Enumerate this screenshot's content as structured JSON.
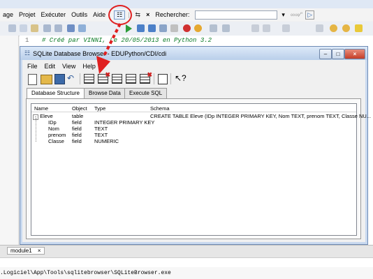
{
  "ide": {
    "menu": [
      "age",
      "Projet",
      "Exécuter",
      "Outils",
      "Aide"
    ],
    "search_label": "Rechercher:",
    "search_value": "",
    "code_line_number": "1",
    "code_line": "# Créé par VINNI, Le 20/05/2013 en Python 3.2",
    "bottom_tab": "module1",
    "status_path": ".Logiciel\\App\\Tools\\sqlitebrowser\\SQLiteBrowser.exe"
  },
  "sqlite": {
    "title": "SQLite Database Browser - EDUPython/CDI/cdi",
    "menu": [
      "File",
      "Edit",
      "View",
      "Help"
    ],
    "tabs": [
      "Database Structure",
      "Browse Data",
      "Execute SQL"
    ],
    "columns": [
      "Name",
      "Object",
      "Type",
      "Schema"
    ],
    "rows": [
      {
        "name": "Eleve",
        "object": "table",
        "type": "",
        "schema": "CREATE TABLE Eleve (IDp INTEGER PRIMARY KEY, Nom TEXT, prenom TEXT, Classe NU..."
      },
      {
        "name": "IDp",
        "object": "field",
        "type": "INTEGER PRIMARY KEY",
        "schema": ""
      },
      {
        "name": "Nom",
        "object": "field",
        "type": "TEXT",
        "schema": ""
      },
      {
        "name": "prenom",
        "object": "field",
        "type": "TEXT",
        "schema": ""
      },
      {
        "name": "Classe",
        "object": "field",
        "type": "NUMERIC",
        "schema": ""
      }
    ]
  },
  "colors": {
    "annotation": "#e02020",
    "accent": "#3b6db3"
  }
}
